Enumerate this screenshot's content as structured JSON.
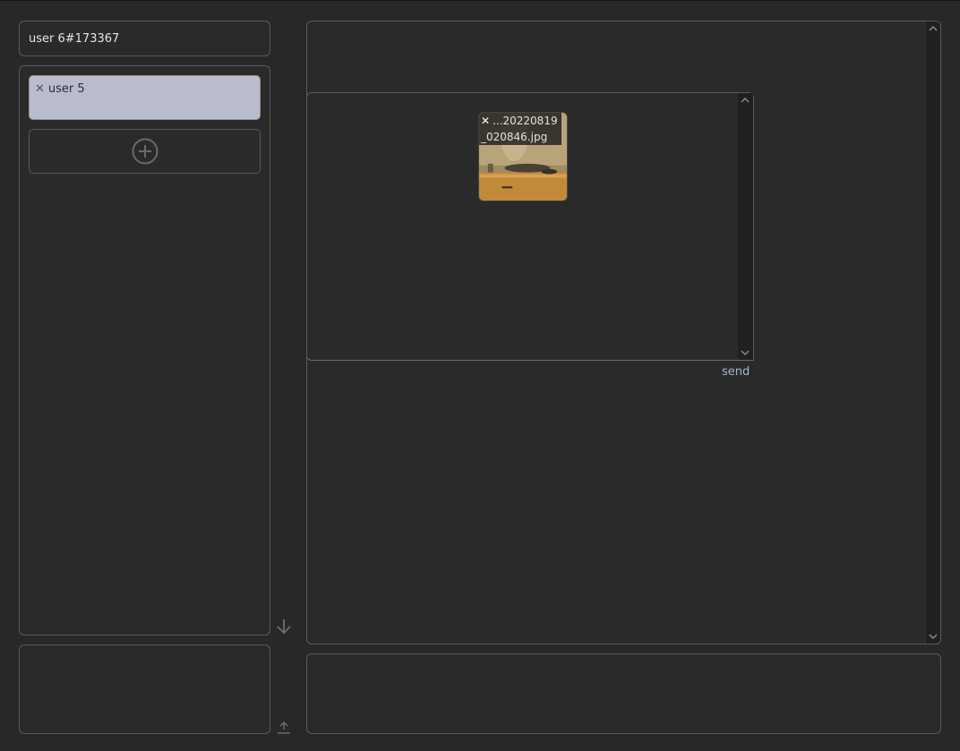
{
  "user": {
    "id_label": "user 6#173367"
  },
  "contacts": {
    "items": [
      {
        "close": "✕",
        "name": "user 5"
      }
    ],
    "add_icon": "plus-circle-icon"
  },
  "chat": {
    "attachment": {
      "close": "✕",
      "filename": "...20220819_020846.jpg"
    },
    "send_label": "send"
  },
  "colors": {
    "background": "#282828",
    "panel_border": "#5a5a5a",
    "selected_contact": "#b8bccb",
    "send_text": "#a9b6c9"
  }
}
